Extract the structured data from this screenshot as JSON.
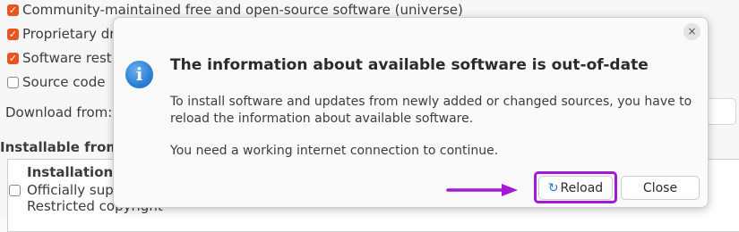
{
  "background": {
    "sources": [
      {
        "label": "Community-maintained free and open-source software (universe)",
        "checked": true
      },
      {
        "label": "Proprietary dr",
        "checked": true
      },
      {
        "label": "Software restr",
        "checked": true
      },
      {
        "label": "Source code",
        "checked": false
      }
    ],
    "download_from_label": "Download from:",
    "installable_label": "Installable from C",
    "table": {
      "heading": "Installation m",
      "line1": "Officially sup",
      "line2": "Restricted copyright"
    }
  },
  "dialog": {
    "title": "The information about available software is out-of-date",
    "body_line1": "To install software and updates from newly added or changed sources, you have to reload the information about available software.",
    "body_line2": "You need a working internet connection to continue.",
    "reload_label": "Reload",
    "close_label": "Close",
    "close_glyph": "×",
    "info_glyph": "i",
    "reload_glyph": "↻"
  },
  "colors": {
    "highlight": "#a319d6",
    "checkbox_accent": "#e95420"
  }
}
